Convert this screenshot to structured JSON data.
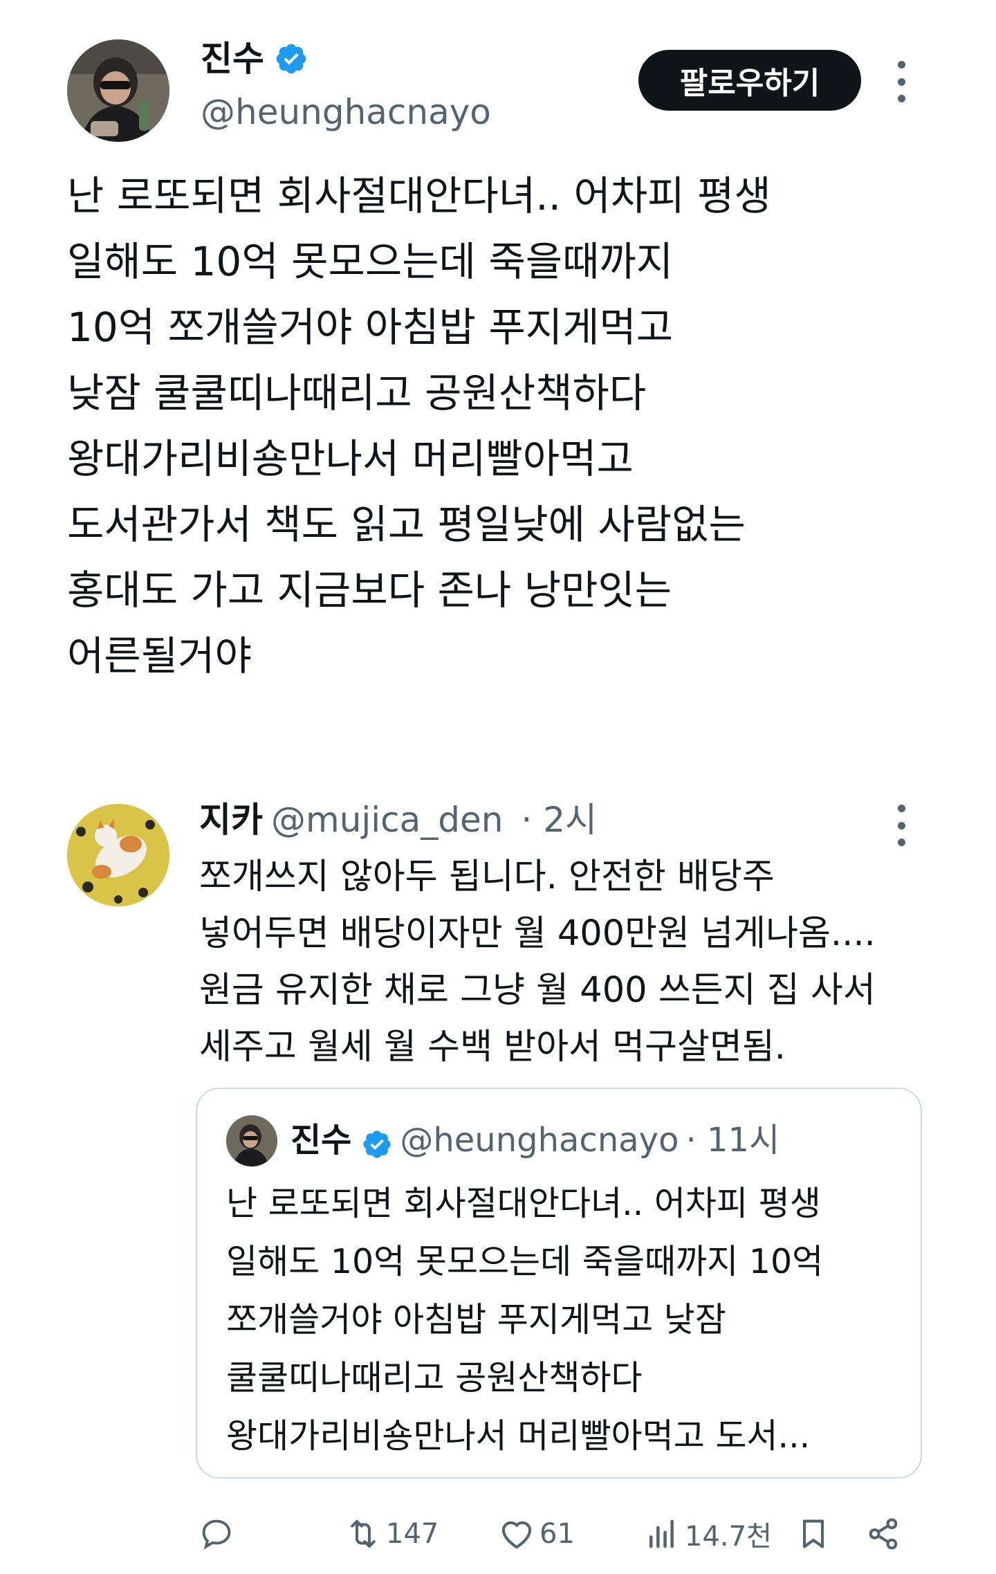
{
  "main_tweet": {
    "author_name": "진수",
    "author_handle": "@heunghacnayo",
    "follow_label": "팔로우하기",
    "text": "난 로또되면 회사절대안다녀.. 어차피 평생\n일해도 10억 못모으는데 죽을때까지\n10억 쪼개쓸거야 아침밥 푸지게먹고\n낮잠 쿨쿨띠나때리고 공원산책하다\n왕대가리비숑만나서 머리빨아먹고\n도서관가서 책도 읽고 평일낮에 사람없는\n홍대도 가고 지금보다 존나 낭만잇는\n어른될거야"
  },
  "reply": {
    "author_name": "지카",
    "author_handle": "@mujica_den",
    "time": "· 2시",
    "text": "쪼개쓰지 않아두 됩니다. 안전한 배당주\n넣어두면 배당이자만 월 400만원 넘게나옴....\n원금 유지한 채로 그냥 월 400 쓰든지 집 사서\n세주고 월세 월 수백 받아서 먹구살면됨."
  },
  "quoted_tweet": {
    "author_name": "진수",
    "author_handle": "@heunghacnayo",
    "time": "· 11시",
    "text": "난 로또되면 회사절대안다녀.. 어차피 평생\n일해도 10억 못모으는데 죽을때까지 10억\n쪼개쓸거야 아침밥 푸지게먹고 낮잠\n쿨쿨띠나때리고 공원산책하다\n왕대가리비숑만나서 머리빨아먹고 도서..."
  },
  "actions": {
    "reply_icon": "speech-bubble-icon",
    "retweet_icon": "retweet-icon",
    "retweet_count": "147",
    "like_icon": "heart-icon",
    "like_count": "61",
    "views_icon": "bar-chart-icon",
    "views_count": "14.7천",
    "bookmark_icon": "bookmark-icon",
    "share_icon": "share-icon"
  },
  "colors": {
    "text": "#0f1419",
    "secondary": "#536471",
    "verified": "#1d9bf0",
    "follow_bg": "#0f1419",
    "border": "#cfd9de"
  }
}
